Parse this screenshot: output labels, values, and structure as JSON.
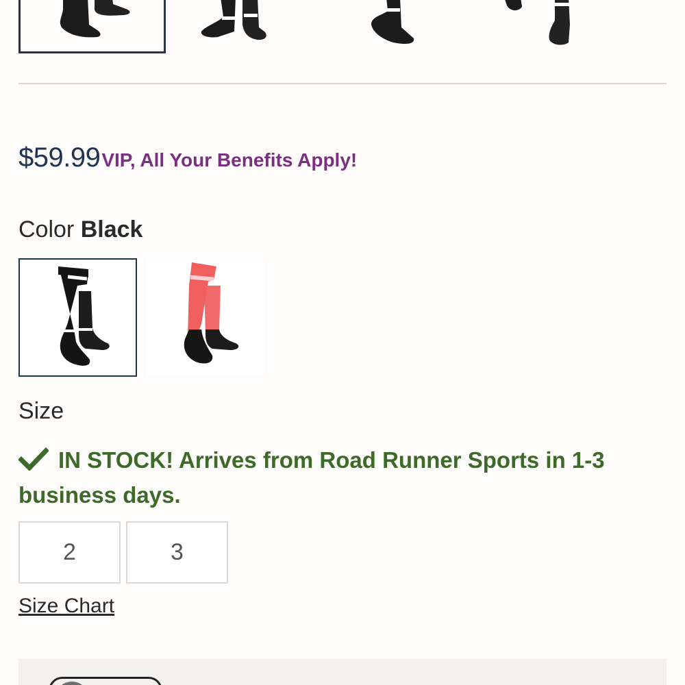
{
  "thumbnails": [
    {
      "name": "thumb-1",
      "selected": true
    },
    {
      "name": "thumb-2",
      "selected": false
    },
    {
      "name": "thumb-3",
      "selected": false
    },
    {
      "name": "thumb-4",
      "selected": false
    }
  ],
  "price": {
    "amount": "$59.99",
    "vip_message": "VIP, All Your Benefits Apply!"
  },
  "color": {
    "label": "Color",
    "selected_value": "Black",
    "swatches": [
      {
        "name": "Black",
        "selected": true
      },
      {
        "name": "Pink",
        "selected": false
      }
    ]
  },
  "size": {
    "label": "Size",
    "stock_message": "IN STOCK! Arrives from Road Runner Sports in 1-3 business days.",
    "options": [
      "2",
      "3"
    ],
    "size_chart_link": "Size Chart"
  },
  "colors": {
    "navy": "#1f3352",
    "vip_purple": "#7a2f80",
    "stock_green": "#3d6a28",
    "sock_pink": "#f06060"
  },
  "icons": {
    "stock": "checkmark-icon"
  }
}
